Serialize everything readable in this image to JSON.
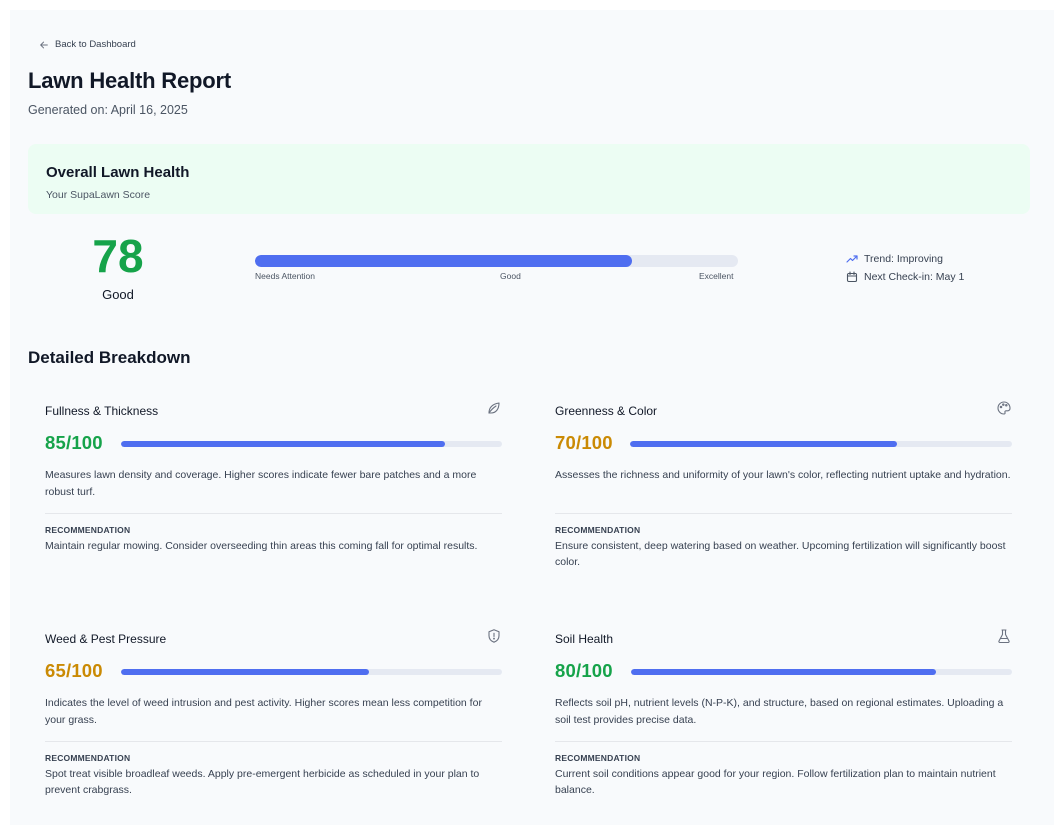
{
  "header": {
    "back_label": "Back to Dashboard",
    "title": "Lawn Health Report",
    "generated": "Generated on: April 16, 2025"
  },
  "overall": {
    "title": "Overall Lawn Health",
    "subtitle": "Your SupaLawn Score",
    "score": "78",
    "rating": "Good",
    "progress_fraction": 0.78,
    "scale": [
      "Needs Attention",
      "Good",
      "Excellent"
    ],
    "trend": "Trend: Improving",
    "next_checkin": "Next Check-in: May 1"
  },
  "breakdown": {
    "title": "Detailed Breakdown",
    "categories": [
      {
        "name": "Fullness & Thickness",
        "icon": "leaf-icon",
        "score": "85/100",
        "value": 85,
        "score_color": "#16a34a",
        "description": "Measures lawn density and coverage. Higher scores indicate fewer bare patches and a more robust turf.",
        "rec_label": "RECOMMENDATION",
        "recommendation": "Maintain regular mowing. Consider overseeding thin areas this coming fall for optimal results."
      },
      {
        "name": "Greenness & Color",
        "icon": "palette-icon",
        "score": "70/100",
        "value": 70,
        "score_color": "#ca8a04",
        "description": "Assesses the richness and uniformity of your lawn's color, reflecting nutrient uptake and hydration.",
        "rec_label": "RECOMMENDATION",
        "recommendation": "Ensure consistent, deep watering based on weather. Upcoming fertilization will significantly boost color."
      },
      {
        "name": "Weed & Pest Pressure",
        "icon": "shield-alert-icon",
        "score": "65/100",
        "value": 65,
        "score_color": "#ca8a04",
        "description": "Indicates the level of weed intrusion and pest activity. Higher scores mean less competition for your grass.",
        "rec_label": "RECOMMENDATION",
        "recommendation": "Spot treat visible broadleaf weeds. Apply pre-emergent herbicide as scheduled in your plan to prevent crabgrass."
      },
      {
        "name": "Soil Health",
        "icon": "flask-icon",
        "score": "80/100",
        "value": 80,
        "score_color": "#16a34a",
        "description": "Reflects soil pH, nutrient levels (N-P-K), and structure, based on regional estimates. Uploading a soil test provides precise data.",
        "rec_label": "RECOMMENDATION",
        "recommendation": "Current soil conditions appear good for your region. Follow fertilization plan to maintain nutrient balance."
      }
    ]
  },
  "colors": {
    "accent": "#4f6ef0",
    "good": "#16a34a",
    "fair": "#ca8a04",
    "track": "#e5e9f2",
    "overall_bg": "#ecfdf3"
  }
}
